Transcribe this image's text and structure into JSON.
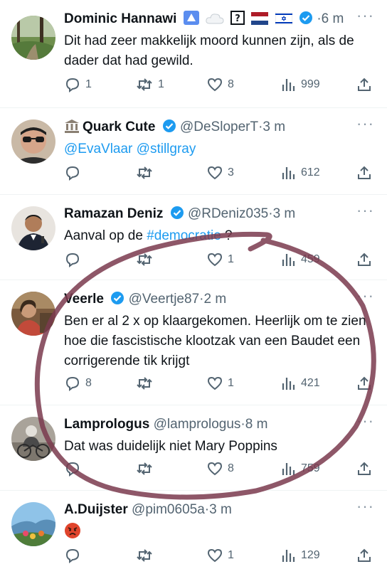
{
  "tweets": [
    {
      "name": "Dominic Hannawi",
      "handle": "",
      "time": "6 m",
      "body": "Dit had zeer makkelijk moord kunnen zijn, als de dader dat had gewild.",
      "replies": "1",
      "reposts": "1",
      "likes": "8",
      "views": "999"
    },
    {
      "name": "Quark Cute",
      "name_prefix_icon": "classical-building-emoji",
      "handle": "@DeSloperT",
      "time": "3 m",
      "mentions": [
        "@EvaVlaar",
        "@stillgray"
      ],
      "replies": "",
      "reposts": "",
      "likes": "3",
      "views": "612"
    },
    {
      "name": "Ramazan Deniz",
      "handle": "@RDeniz035",
      "time": "3 m",
      "body_prefix": "Aanval op de ",
      "hashtag": "#democratie",
      "body_suffix": " ?",
      "replies": "",
      "reposts": "",
      "likes": "1",
      "views": "459"
    },
    {
      "name": "Veerle",
      "handle": "@Veertje87",
      "time": "2 m",
      "body": "Ben er al 2 x op klaargekomen. Heerlijk om te zien hoe die fascistische klootzak van een Baudet een corrigerende tik krijgt",
      "replies": "8",
      "reposts": "",
      "likes": "1",
      "views": "421"
    },
    {
      "name": "Lamprologus",
      "handle": "@lamprologus",
      "time": "8 m",
      "body": "Dat was duidelijk niet Mary Poppins",
      "replies": "",
      "reposts": "",
      "likes": "8",
      "views": "759"
    },
    {
      "name": "A.Duijster",
      "handle": "@pim0605a",
      "time": "3 m",
      "body_icon": "angry-face-emoji",
      "replies": "",
      "reposts": "",
      "likes": "1",
      "views": "129"
    }
  ],
  "separator": "·",
  "more_glyph": "···",
  "colors": {
    "accent": "#1d9bf0",
    "muted": "#536471",
    "annotation_circle": "#7a3a4e"
  }
}
